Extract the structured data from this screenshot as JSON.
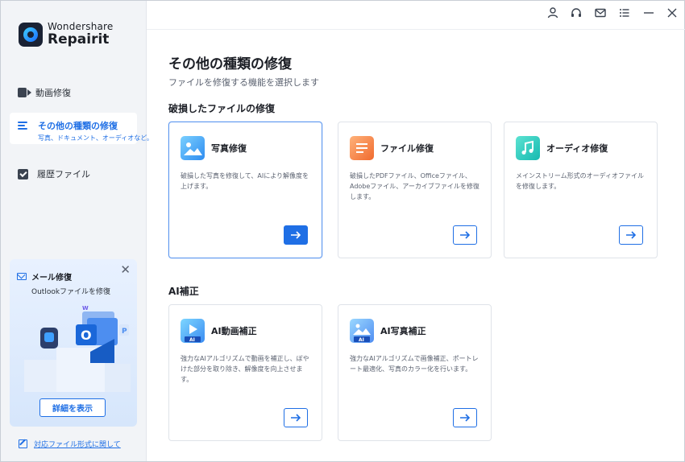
{
  "app": {
    "brand_small": "Wondershare",
    "brand_name": "Repairit"
  },
  "colors": {
    "accent": "#1f6fe5",
    "sidebar_bg": "#f2f4f7",
    "card_border_selected": "#5d97ef"
  },
  "sidebar": {
    "items": [
      {
        "label": "動画修復",
        "icon": "video-camera-icon"
      },
      {
        "label": "その他の種類の修復",
        "sub": "写真、ドキュメント、オーディオなど。",
        "icon": "list-icon",
        "active": true
      },
      {
        "label": "履歴ファイル",
        "icon": "history-check-icon"
      }
    ],
    "promo": {
      "title": "メール修復",
      "subtitle": "Outlookファイルを修復",
      "button": "詳細を表示"
    },
    "footer_link": "対応ファイル形式に関して"
  },
  "titlebar": {
    "icons": [
      "user-icon",
      "headset-icon",
      "mail-icon",
      "menu-icon",
      "minimize-icon",
      "close-icon"
    ]
  },
  "main": {
    "title": "その他の種類の修復",
    "subtitle": "ファイルを修復する機能を選択します",
    "sections": [
      {
        "title": "破損したファイルの修復",
        "cards": [
          {
            "title": "写真修復",
            "desc": "破損した写真を修復して、AIにより解像度を上げます。",
            "icon": "photo-icon",
            "selected": true
          },
          {
            "title": "ファイル修復",
            "desc": "破損したPDFファイル、Officeファイル、Adobeファイル、アーカイブファイルを修復します。",
            "icon": "document-icon"
          },
          {
            "title": "オーディオ修復",
            "desc": "メインストリーム形式のオーディオファイルを修復します。",
            "icon": "music-note-icon"
          }
        ]
      },
      {
        "title": "AI補正",
        "cards": [
          {
            "title": "AI動画補正",
            "desc": "強力なAIアルゴリズムで動画を補正し、ぼやけた部分を取り除き、解像度を向上させます。",
            "icon": "ai-video-icon"
          },
          {
            "title": "AI写真補正",
            "desc": "強力なAIアルゴリズムで画像補正、ポートレート最適化、写真のカラー化を行います。",
            "icon": "ai-photo-icon"
          }
        ]
      }
    ]
  }
}
